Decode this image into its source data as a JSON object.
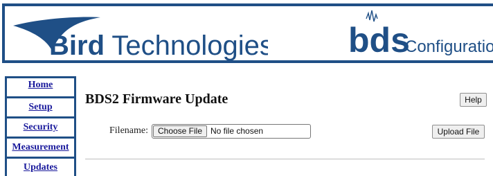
{
  "header": {
    "company_name_bold": "Bird",
    "company_name_rest": " Technologies",
    "registered_mark": "®",
    "product_logo": "bds",
    "product_subtitle": "Configuration",
    "brand_color": "#1f4f86"
  },
  "nav": {
    "items": [
      {
        "label": "Home"
      },
      {
        "label": "Setup"
      },
      {
        "label": "Security"
      },
      {
        "label": "Measurement"
      },
      {
        "label": "Updates"
      }
    ],
    "link_color": "#1a1a9c"
  },
  "main": {
    "title": "BDS2 Firmware Update",
    "help_label": "Help",
    "filename_label": "Filename:",
    "choose_file_label": "Choose File",
    "file_status": "No file chosen",
    "upload_label": "Upload File"
  }
}
